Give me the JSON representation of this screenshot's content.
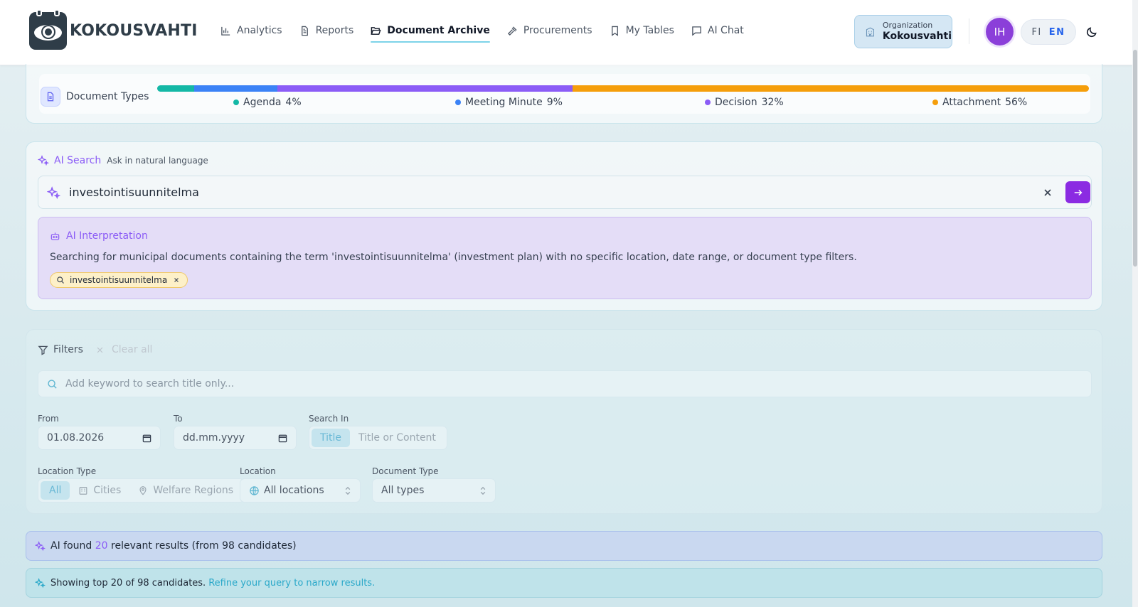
{
  "header": {
    "app_name": "KOKOUSVAHTI",
    "nav": [
      {
        "label": "Analytics",
        "icon": "bar-chart-icon",
        "active": false
      },
      {
        "label": "Reports",
        "icon": "document-icon",
        "active": false
      },
      {
        "label": "Document Archive",
        "icon": "folder-open-icon",
        "active": true
      },
      {
        "label": "Procurements",
        "icon": "gavel-icon",
        "active": false
      },
      {
        "label": "My Tables",
        "icon": "bookmark-icon",
        "active": false
      },
      {
        "label": "AI Chat",
        "icon": "chat-icon",
        "active": false
      }
    ],
    "org_label": "Organization",
    "org_value": "Kokousvahti",
    "avatar_initials": "IH",
    "lang_fi": "FI",
    "lang_en": "EN"
  },
  "doc_types": {
    "label": "Document Types",
    "items": [
      {
        "name": "Agenda",
        "pct": "4%",
        "value": 4,
        "color": "#14b8a6"
      },
      {
        "name": "Meeting Minute",
        "pct": "9%",
        "value": 9,
        "color": "#3b82f6"
      },
      {
        "name": "Decision",
        "pct": "32%",
        "value": 32,
        "color": "#8b5cf6"
      },
      {
        "name": "Attachment",
        "pct": "56%",
        "value": 56,
        "color": "#f59e0b"
      }
    ]
  },
  "ai_search": {
    "title": "AI Search",
    "subtitle": "Ask in natural language",
    "query": "investointisuunnitelma",
    "interpretation_title": "AI Interpretation",
    "interpretation_text": "Searching for municipal documents containing the term 'investointisuunnitelma' (investment plan) with no specific location, date range, or document type filters.",
    "chip": "investointisuunnitelma"
  },
  "filters": {
    "title": "Filters",
    "clear_all": "Clear all",
    "keyword_placeholder": "Add keyword to search title only...",
    "from_label": "From",
    "from_value": "01.08.2026",
    "to_label": "To",
    "to_value": "dd.mm.yyyy",
    "search_in_label": "Search In",
    "search_in_options": [
      "Title",
      "Title or Content"
    ],
    "location_type_label": "Location Type",
    "location_type_options": [
      "All",
      "Cities",
      "Welfare Regions"
    ],
    "location_label": "Location",
    "location_value": "All locations",
    "doc_type_label": "Document Type",
    "doc_type_value": "All types"
  },
  "results": {
    "found_prefix": "AI found",
    "found_count": "20",
    "found_suffix": "relevant results (from 98 candidates)",
    "showing_text": "Showing top 20 of 98 candidates.",
    "refine_link": "Refine your query to narrow results."
  }
}
